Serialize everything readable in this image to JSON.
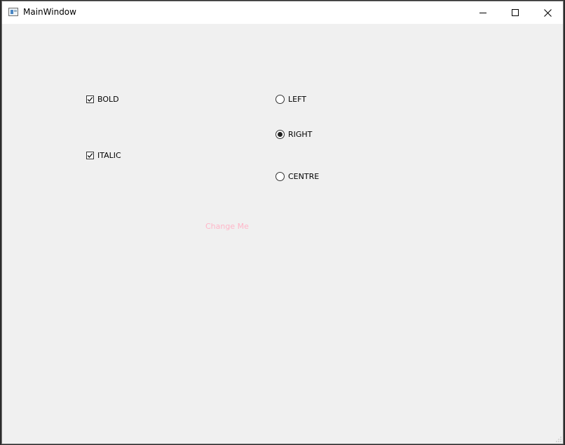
{
  "window": {
    "title": "MainWindow",
    "icons": {
      "app": "app-window-icon",
      "minimize": "minimize-icon",
      "maximize": "maximize-icon",
      "close": "close-icon"
    }
  },
  "checkboxes": [
    {
      "label": "BOLD",
      "checked": true
    },
    {
      "label": "ITALIC",
      "checked": true
    }
  ],
  "radios": [
    {
      "label": "LEFT",
      "selected": false
    },
    {
      "label": "RIGHT",
      "selected": true
    },
    {
      "label": "CENTRE",
      "selected": false
    }
  ],
  "change_label": {
    "text": "Change Me",
    "color": "#ffb6c8"
  }
}
